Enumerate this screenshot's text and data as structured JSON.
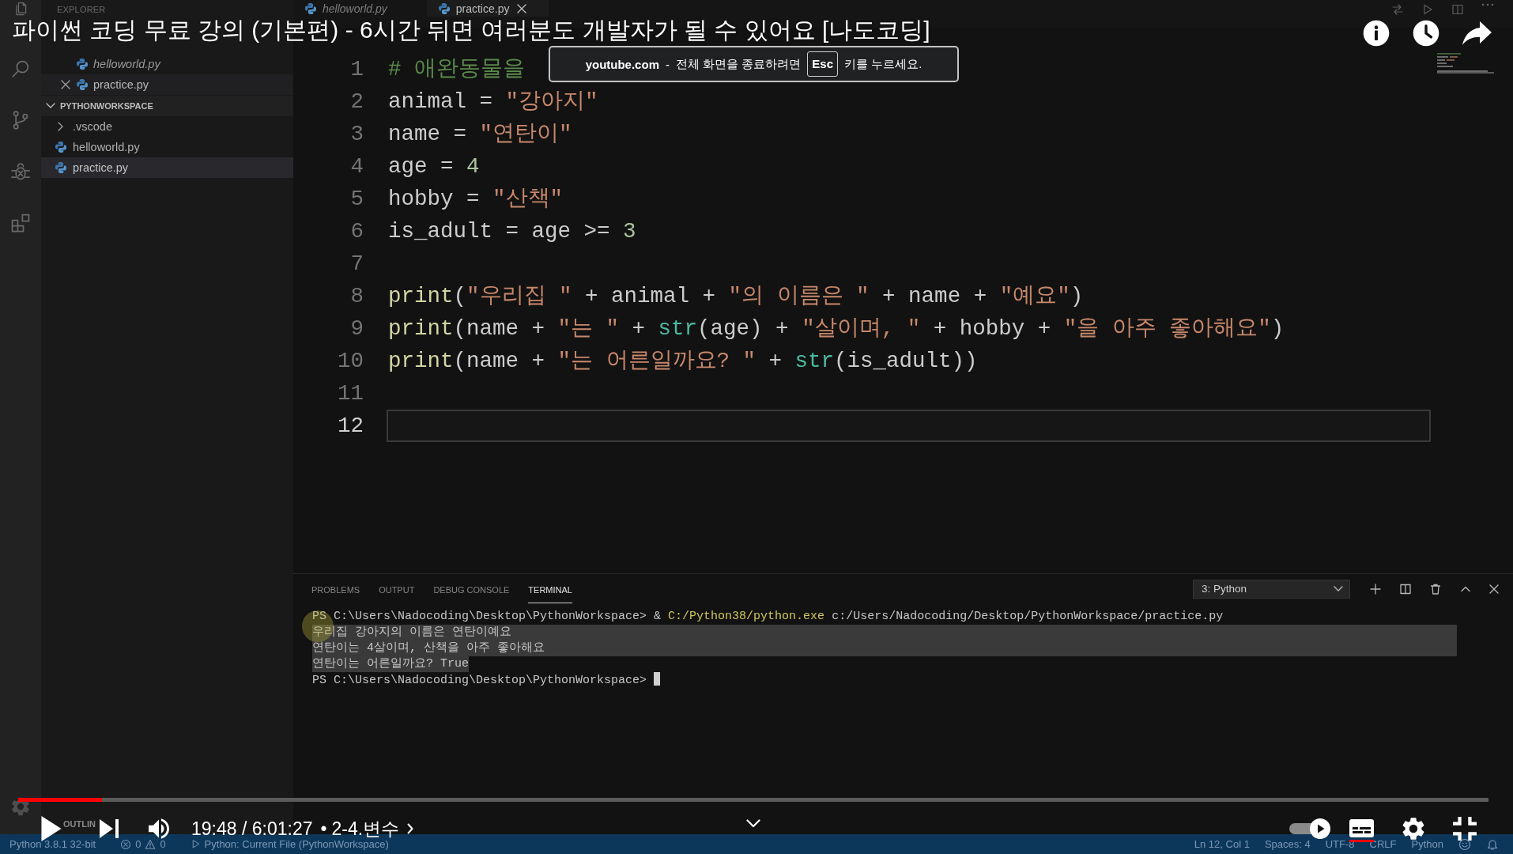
{
  "video_player": {
    "title": "파이썬 코딩 무료 강의 (기본편) - 6시간 뒤면 여러분도 개발자가 될 수 있어요 [나도코딩]",
    "fullscreen_notice": {
      "site": "youtube.com",
      "dash": "-",
      "before_key": "전체 화면을 종료하려면",
      "key": "Esc",
      "after_key": "키를 누르세요."
    },
    "progress": {
      "level": 0.057
    },
    "time": "19:48 / 6:01:27",
    "separator": "•",
    "chapter": "2-4.변수",
    "autoplay": {
      "on": true
    },
    "captions": {
      "on": true
    }
  },
  "editor_window": {
    "explorer": {
      "title": "EXPLORER",
      "open_editors": [
        {
          "name": "helloworld.py",
          "preview": true,
          "selected": false
        },
        {
          "name": "practice.py",
          "preview": false,
          "selected": true
        }
      ],
      "workspace": {
        "name": "PYTHONWORKSPACE",
        "expanded": true,
        "items": [
          {
            "kind": "folder",
            "name": ".vscode",
            "expanded": false,
            "selected": false
          },
          {
            "kind": "file",
            "name": "helloworld.py",
            "selected": false
          },
          {
            "kind": "file",
            "name": "practice.py",
            "selected": true
          }
        ]
      },
      "outline": {
        "title": "OUTLIN"
      }
    },
    "tabs": [
      {
        "name": "helloworld.py",
        "preview": true,
        "selected": false
      },
      {
        "name": "practice.py",
        "preview": false,
        "selected": true
      }
    ],
    "code": [
      {
        "number": "1",
        "current": false,
        "tokens": [
          {
            "kind": "comment",
            "text": "# 애완동물을"
          }
        ]
      },
      {
        "number": "2",
        "current": false,
        "tokens": [
          {
            "kind": "plain",
            "text": "animal = "
          },
          {
            "kind": "string",
            "text": "\"강아지\""
          }
        ]
      },
      {
        "number": "3",
        "current": false,
        "tokens": [
          {
            "kind": "plain",
            "text": "name = "
          },
          {
            "kind": "string",
            "text": "\"연탄이\""
          }
        ]
      },
      {
        "number": "4",
        "current": false,
        "tokens": [
          {
            "kind": "plain",
            "text": "age = "
          },
          {
            "kind": "number",
            "text": "4"
          }
        ]
      },
      {
        "number": "5",
        "current": false,
        "tokens": [
          {
            "kind": "plain",
            "text": "hobby = "
          },
          {
            "kind": "string",
            "text": "\"산책\""
          }
        ]
      },
      {
        "number": "6",
        "current": false,
        "tokens": [
          {
            "kind": "plain",
            "text": "is_adult = age >= "
          },
          {
            "kind": "number",
            "text": "3"
          }
        ]
      },
      {
        "number": "7",
        "current": false
      },
      {
        "number": "8",
        "current": false,
        "tokens": [
          {
            "kind": "function",
            "text": "print"
          },
          {
            "kind": "plain",
            "text": "("
          },
          {
            "kind": "string",
            "text": "\"우리집 \""
          },
          {
            "kind": "plain",
            "text": " + animal + "
          },
          {
            "kind": "string",
            "text": "\"의 이름은 \""
          },
          {
            "kind": "plain",
            "text": " + name + "
          },
          {
            "kind": "string",
            "text": "\"예요\""
          },
          {
            "kind": "plain",
            "text": ")"
          }
        ]
      },
      {
        "number": "9",
        "current": false,
        "tokens": [
          {
            "kind": "function",
            "text": "print"
          },
          {
            "kind": "plain",
            "text": "(name + "
          },
          {
            "kind": "string",
            "text": "\"는 \""
          },
          {
            "kind": "plain",
            "text": " + "
          },
          {
            "kind": "builtin",
            "text": "str"
          },
          {
            "kind": "plain",
            "text": "(age) + "
          },
          {
            "kind": "string",
            "text": "\"살이며, \""
          },
          {
            "kind": "plain",
            "text": " + hobby + "
          },
          {
            "kind": "string",
            "text": "\"을 아주 좋아해요\""
          },
          {
            "kind": "plain",
            "text": ")"
          }
        ]
      },
      {
        "number": "10",
        "current": false,
        "tokens": [
          {
            "kind": "function",
            "text": "print"
          },
          {
            "kind": "plain",
            "text": "(name + "
          },
          {
            "kind": "string",
            "text": "\"는 어른일까요? \""
          },
          {
            "kind": "plain",
            "text": " + "
          },
          {
            "kind": "builtin",
            "text": "str"
          },
          {
            "kind": "plain",
            "text": "(is_adult))"
          }
        ]
      },
      {
        "number": "11",
        "current": false
      },
      {
        "number": "12",
        "current": true
      }
    ],
    "panel": {
      "tabs": [
        {
          "label": "PROBLEMS",
          "selected": false
        },
        {
          "label": "OUTPUT",
          "selected": false
        },
        {
          "label": "DEBUG CONSOLE",
          "selected": false
        },
        {
          "label": "TERMINAL",
          "selected": true
        }
      ],
      "shell": "3: Python",
      "terminal": [
        {
          "selected": false,
          "cursor": false,
          "tokens": [
            {
              "kind": "plain",
              "text": "PS C:\\Users\\Nadocoding\\Desktop\\PythonWorkspace> & "
            },
            {
              "kind": "path",
              "text": "C:/Python38/python.exe"
            },
            {
              "kind": "plain",
              "text": " c:/Users/Nadocoding/Desktop/PythonWorkspace/practice.py"
            }
          ]
        },
        {
          "selected": true,
          "cursor": false,
          "tokens": [
            {
              "kind": "plain",
              "text": "우리집 강아지의 이름은 연탄이예요"
            }
          ]
        },
        {
          "selected": true,
          "cursor": false,
          "tokens": [
            {
              "kind": "plain",
              "text": "연탄이는 4살이며, 산책을 아주 좋아해요"
            }
          ]
        },
        {
          "selected": true,
          "cursor": false,
          "tokens": [
            {
              "kind": "plain",
              "text": "연탄이는 어른일까요? True"
            }
          ]
        },
        {
          "selected": false,
          "cursor": true,
          "tokens": [
            {
              "kind": "plain",
              "text": "PS C:\\Users\\Nadocoding\\Desktop\\PythonWorkspace>"
            }
          ]
        }
      ]
    },
    "status_bar": {
      "interpreter": "Python 3.8.1 32-bit",
      "errors": "0",
      "warnings": "0",
      "launch": "Python: Current File (PythonWorkspace)",
      "right": [
        "Ln 12, Col 1",
        "Spaces: 4",
        "UTF-8",
        "CRLF",
        "Python"
      ]
    }
  }
}
